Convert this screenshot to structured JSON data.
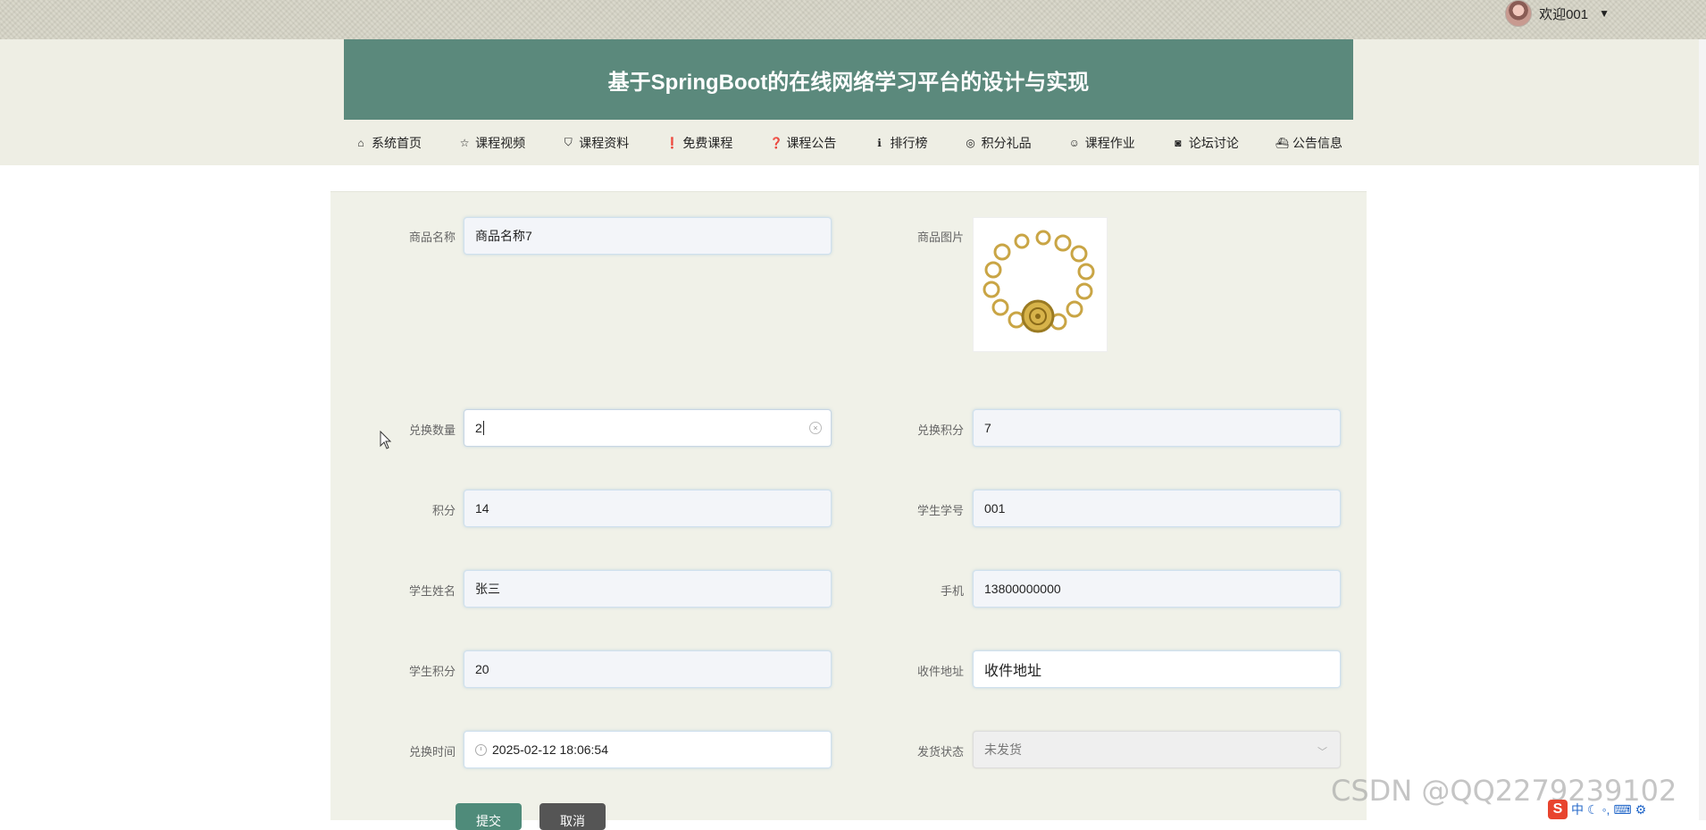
{
  "header": {
    "user_greeting": "欢迎001",
    "caret": "▼",
    "site_title": "基于SpringBoot的在线网络学习平台的设计与实现"
  },
  "nav": {
    "items": [
      {
        "label": "系统首页",
        "icon": "home-icon",
        "glyph": "⌂"
      },
      {
        "label": "课程视频",
        "icon": "star-icon",
        "glyph": "☆"
      },
      {
        "label": "课程资料",
        "icon": "bag-icon",
        "glyph": "⛉"
      },
      {
        "label": "免费课程",
        "icon": "alert-icon",
        "glyph": "❗"
      },
      {
        "label": "课程公告",
        "icon": "question-icon",
        "glyph": "❓"
      },
      {
        "label": "排行榜",
        "icon": "info-icon",
        "glyph": "ℹ"
      },
      {
        "label": "积分礼品",
        "icon": "gift-icon",
        "glyph": "◎"
      },
      {
        "label": "课程作业",
        "icon": "smile-icon",
        "glyph": "☺"
      },
      {
        "label": "论坛讨论",
        "icon": "camera-icon",
        "glyph": "◙"
      },
      {
        "label": "公告信息",
        "icon": "ship-icon",
        "glyph": "⛴"
      }
    ]
  },
  "form": {
    "product_name": {
      "label": "商品名称",
      "value": "商品名称7"
    },
    "product_image": {
      "label": "商品图片"
    },
    "exchange_quantity": {
      "label": "兑换数量",
      "value": "2"
    },
    "exchange_points": {
      "label": "兑换积分",
      "value": "7"
    },
    "points": {
      "label": "积分",
      "value": "14"
    },
    "student_id": {
      "label": "学生学号",
      "value": "001"
    },
    "student_name": {
      "label": "学生姓名",
      "value": "张三"
    },
    "phone": {
      "label": "手机",
      "value": "13800000000"
    },
    "student_points": {
      "label": "学生积分",
      "value": "20"
    },
    "address": {
      "label": "收件地址",
      "value": "收件地址"
    },
    "exchange_time": {
      "label": "兑换时间",
      "value": "2025-02-12 18:06:54"
    },
    "ship_status": {
      "label": "发货状态",
      "value": "未发货"
    }
  },
  "buttons": {
    "submit": "提交",
    "cancel": "取消"
  },
  "overlay": {
    "watermark": "CSDN @QQ2279239102",
    "ime_logo": "S",
    "ime_text": "中"
  },
  "colors": {
    "title_bar": "#5b897c",
    "submit_button": "#4f8b7a",
    "cancel_button": "#555555",
    "panel": "#f0f1e8"
  }
}
